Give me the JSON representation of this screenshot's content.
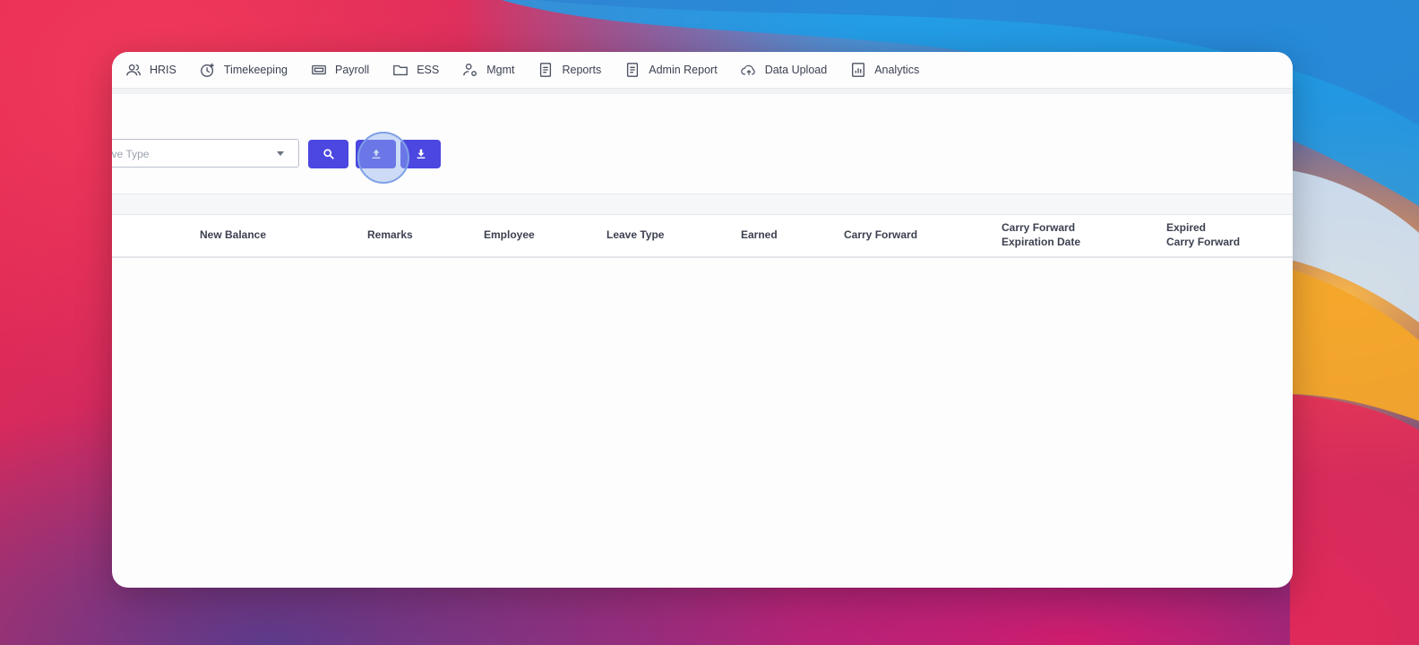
{
  "nav": {
    "items": [
      {
        "label": "HRIS",
        "icon": "users-icon"
      },
      {
        "label": "Timekeeping",
        "icon": "clock-plus-icon"
      },
      {
        "label": "Payroll",
        "icon": "cash-icon"
      },
      {
        "label": "ESS",
        "icon": "folder-icon"
      },
      {
        "label": "Mgmt",
        "icon": "user-gear-icon"
      },
      {
        "label": "Reports",
        "icon": "document-icon"
      },
      {
        "label": "Admin Report",
        "icon": "document-icon"
      },
      {
        "label": "Data Upload",
        "icon": "cloud-upload-icon"
      },
      {
        "label": "Analytics",
        "icon": "bar-chart-icon"
      }
    ]
  },
  "filters": {
    "leave_type_placeholder": "ave Type",
    "search_icon": "search-icon",
    "upload_icon": "upload-icon",
    "download_icon": "download-icon"
  },
  "table": {
    "headers": [
      {
        "line1": "New Balance",
        "line2": ""
      },
      {
        "line1": "Remarks",
        "line2": ""
      },
      {
        "line1": "Employee",
        "line2": ""
      },
      {
        "line1": "Leave Type",
        "line2": ""
      },
      {
        "line1": "Earned",
        "line2": ""
      },
      {
        "line1": "Carry Forward",
        "line2": ""
      },
      {
        "line1": "Carry Forward",
        "line2": "Expiration Date"
      },
      {
        "line1": "Expired",
        "line2": "Carry Forward"
      }
    ]
  },
  "colors": {
    "accent": "#4b47e0",
    "text": "#3c4150"
  }
}
